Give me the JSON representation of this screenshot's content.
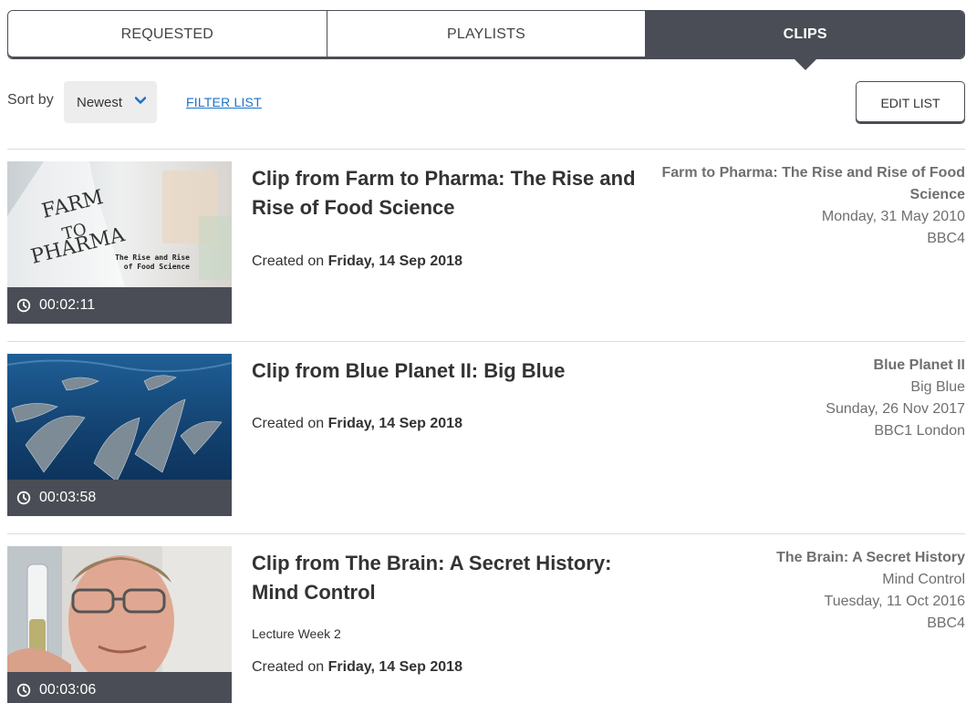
{
  "tabs": [
    {
      "label": "REQUESTED",
      "active": false
    },
    {
      "label": "PLAYLISTS",
      "active": false
    },
    {
      "label": "CLIPS",
      "active": true
    }
  ],
  "toolbar": {
    "sort_label": "Sort by",
    "sort_value": "Newest",
    "filter_label": "FILTER LIST",
    "edit_label": "EDIT LIST"
  },
  "clips": [
    {
      "title": "Clip from Farm to Pharma: The Rise and Rise of Food Science",
      "note": "",
      "created_prefix": "Created on",
      "created_date": "Friday, 14 Sep 2018",
      "duration": "00:02:11",
      "thumb_icon": "farm-to-pharma-thumbnail",
      "thumb_text": {
        "line1": "FARM",
        "line2": "TO",
        "line3": "PHARMA",
        "sub1": "The Rise and Rise",
        "sub2": "of Food Science"
      },
      "programme": "Farm to Pharma: The Rise and Rise of Food Science",
      "episode": "",
      "broadcast_date": "Monday, 31 May 2010",
      "channel": "BBC4"
    },
    {
      "title": "Clip from Blue Planet II: Big Blue",
      "note": "",
      "created_prefix": "Created on",
      "created_date": "Friday, 14 Sep 2018",
      "duration": "00:03:58",
      "thumb_icon": "dolphins-thumbnail",
      "programme": "Blue Planet II",
      "episode": "Big Blue",
      "broadcast_date": "Sunday, 26 Nov 2017",
      "channel": "BBC1 London"
    },
    {
      "title": "Clip from The Brain: A Secret History: Mind Control",
      "note": "Lecture Week 2",
      "created_prefix": "Created on",
      "created_date": "Friday, 14 Sep 2018",
      "duration": "00:03:06",
      "thumb_icon": "presenter-thumbnail",
      "programme": "The Brain: A Secret History",
      "episode": "Mind Control",
      "broadcast_date": "Tuesday, 11 Oct 2016",
      "channel": "BBC4"
    }
  ],
  "colors": {
    "tab_active": "#4a4d55",
    "link": "#1a73c8",
    "meta": "#6f6f6f"
  }
}
